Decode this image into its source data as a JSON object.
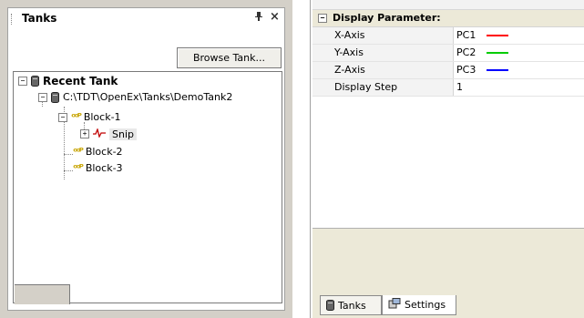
{
  "tanks_panel": {
    "title": "Tanks",
    "pin_glyph": "ᵖ",
    "close_glyph": "×",
    "browse_label": "Browse Tank...",
    "tree": {
      "root_label": "Recent Tank",
      "tank_path": "C:\\TDT\\OpenEx\\Tanks\\DemoTank2",
      "blocks": [
        "Block-1",
        "Block-2",
        "Block-3"
      ],
      "store_label": "Snip"
    }
  },
  "properties": {
    "category_label": "Display Parameter:",
    "rows": [
      {
        "key": "X-Axis",
        "value": "PC1",
        "color": "#ff0000"
      },
      {
        "key": "Y-Axis",
        "value": "PC2",
        "color": "#00cc00"
      },
      {
        "key": "Z-Axis",
        "value": "PC3",
        "color": "#0000ff"
      },
      {
        "key": "Display Step",
        "value": "1"
      }
    ]
  },
  "tabs": [
    {
      "label": "Tanks",
      "icon": "tank-icon"
    },
    {
      "label": "Settings",
      "icon": "settings-icon"
    }
  ]
}
